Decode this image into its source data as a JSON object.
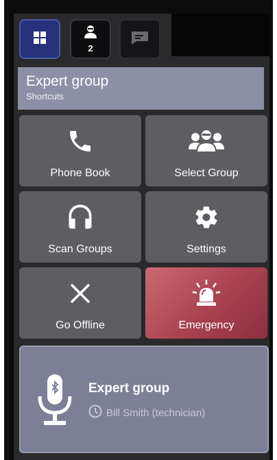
{
  "tabs": [
    {
      "icon": "grid-icon",
      "active": true
    },
    {
      "icon": "user-icon",
      "badge": "2"
    },
    {
      "icon": "message-icon"
    }
  ],
  "group": {
    "title": "Expert group",
    "subtitle": "Shortcuts"
  },
  "tiles": [
    {
      "label": "Phone Book",
      "icon": "phone-icon"
    },
    {
      "label": "Select Group",
      "icon": "group-icon"
    },
    {
      "label": "Scan Groups",
      "icon": "headphones-icon"
    },
    {
      "label": "Settings",
      "icon": "gear-icon"
    },
    {
      "label": "Go Offline",
      "icon": "close-icon"
    },
    {
      "label": "Emergency",
      "icon": "alarm-icon",
      "color": "#a8424f"
    }
  ],
  "ptt": {
    "title": "Expert group",
    "speaker": "Bill Smith (technician)"
  },
  "colors": {
    "accent": "#26327a",
    "header": "#8c8fa6",
    "tile": "#5e5e62",
    "emergency": "#a8424f",
    "ptt": "#7d7f96"
  }
}
